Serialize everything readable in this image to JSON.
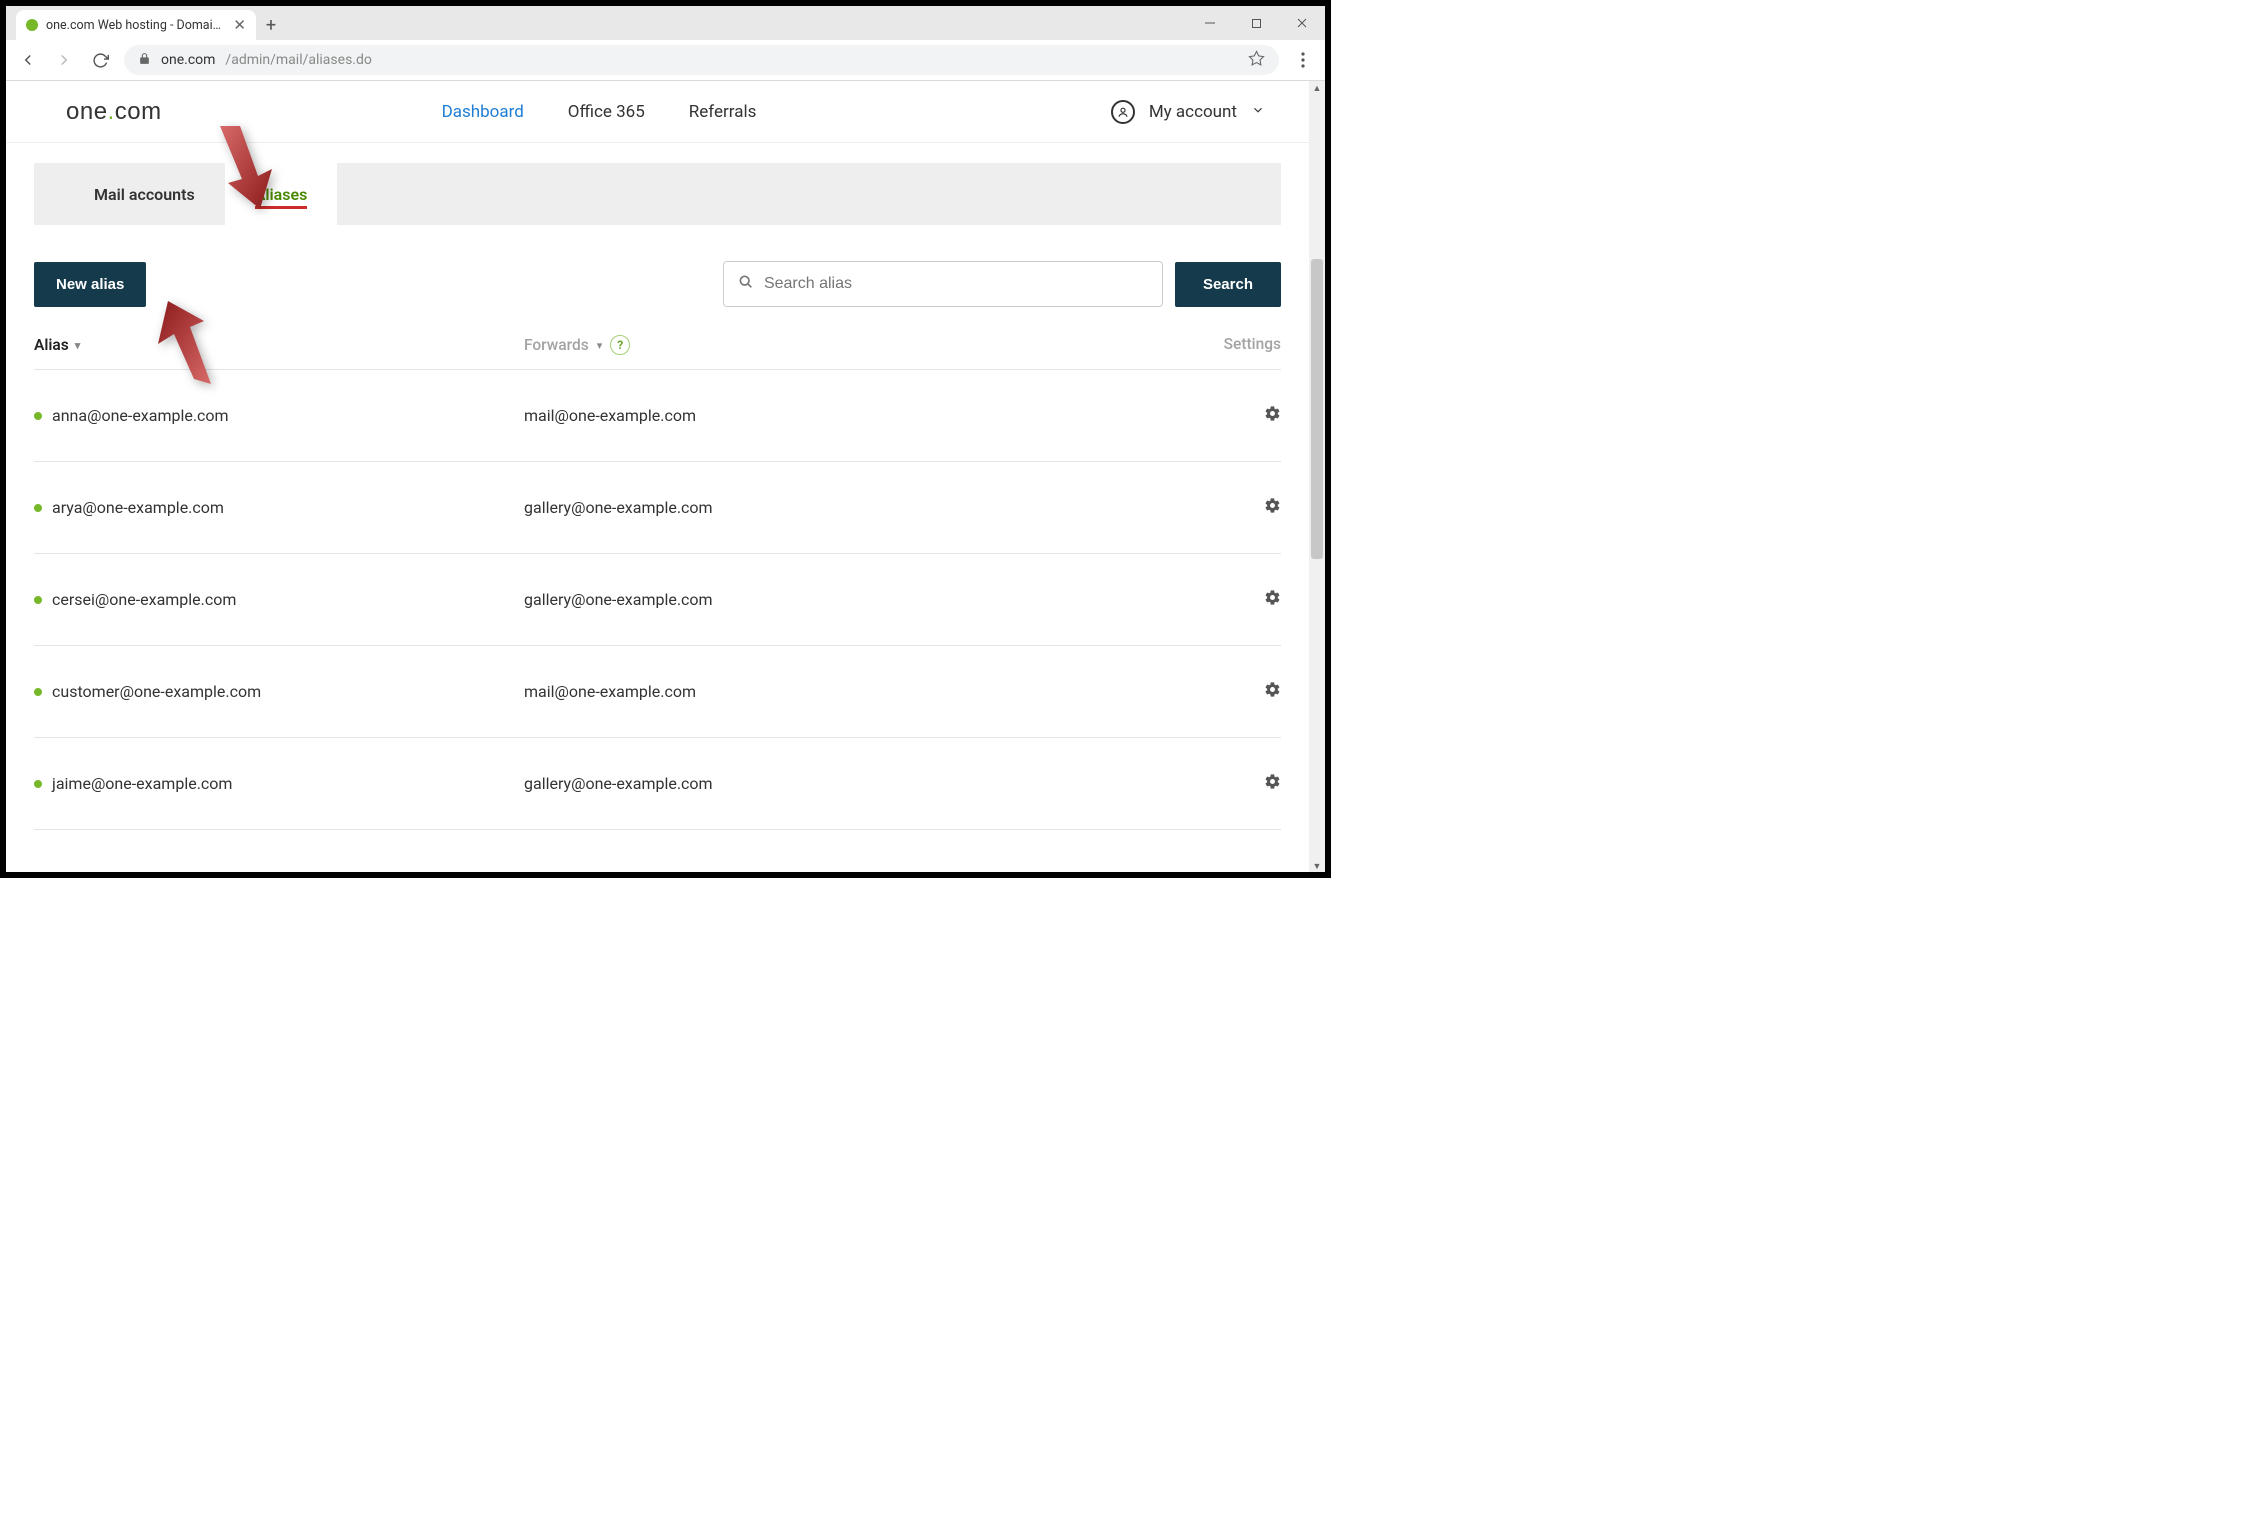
{
  "browser": {
    "tab_title": "one.com Web hosting  -  Domain…",
    "url_host": "one.com",
    "url_path": "/admin/mail/aliases.do"
  },
  "logo": {
    "part1": "one",
    "dot": ".",
    "part2": "com"
  },
  "nav": {
    "dashboard": "Dashboard",
    "office365": "Office 365",
    "referrals": "Referrals",
    "my_account": "My account"
  },
  "tabs": {
    "mail_accounts": "Mail accounts",
    "aliases": "Aliases"
  },
  "actions": {
    "new_alias": "New alias",
    "search_placeholder": "Search alias",
    "search_button": "Search"
  },
  "columns": {
    "alias": "Alias",
    "forwards": "Forwards",
    "settings": "Settings"
  },
  "rows": [
    {
      "alias": "anna@one-example.com",
      "forward": "mail@one-example.com"
    },
    {
      "alias": "arya@one-example.com",
      "forward": "gallery@one-example.com"
    },
    {
      "alias": "cersei@one-example.com",
      "forward": "gallery@one-example.com"
    },
    {
      "alias": "customer@one-example.com",
      "forward": "mail@one-example.com"
    },
    {
      "alias": "jaime@one-example.com",
      "forward": "gallery@one-example.com"
    }
  ]
}
